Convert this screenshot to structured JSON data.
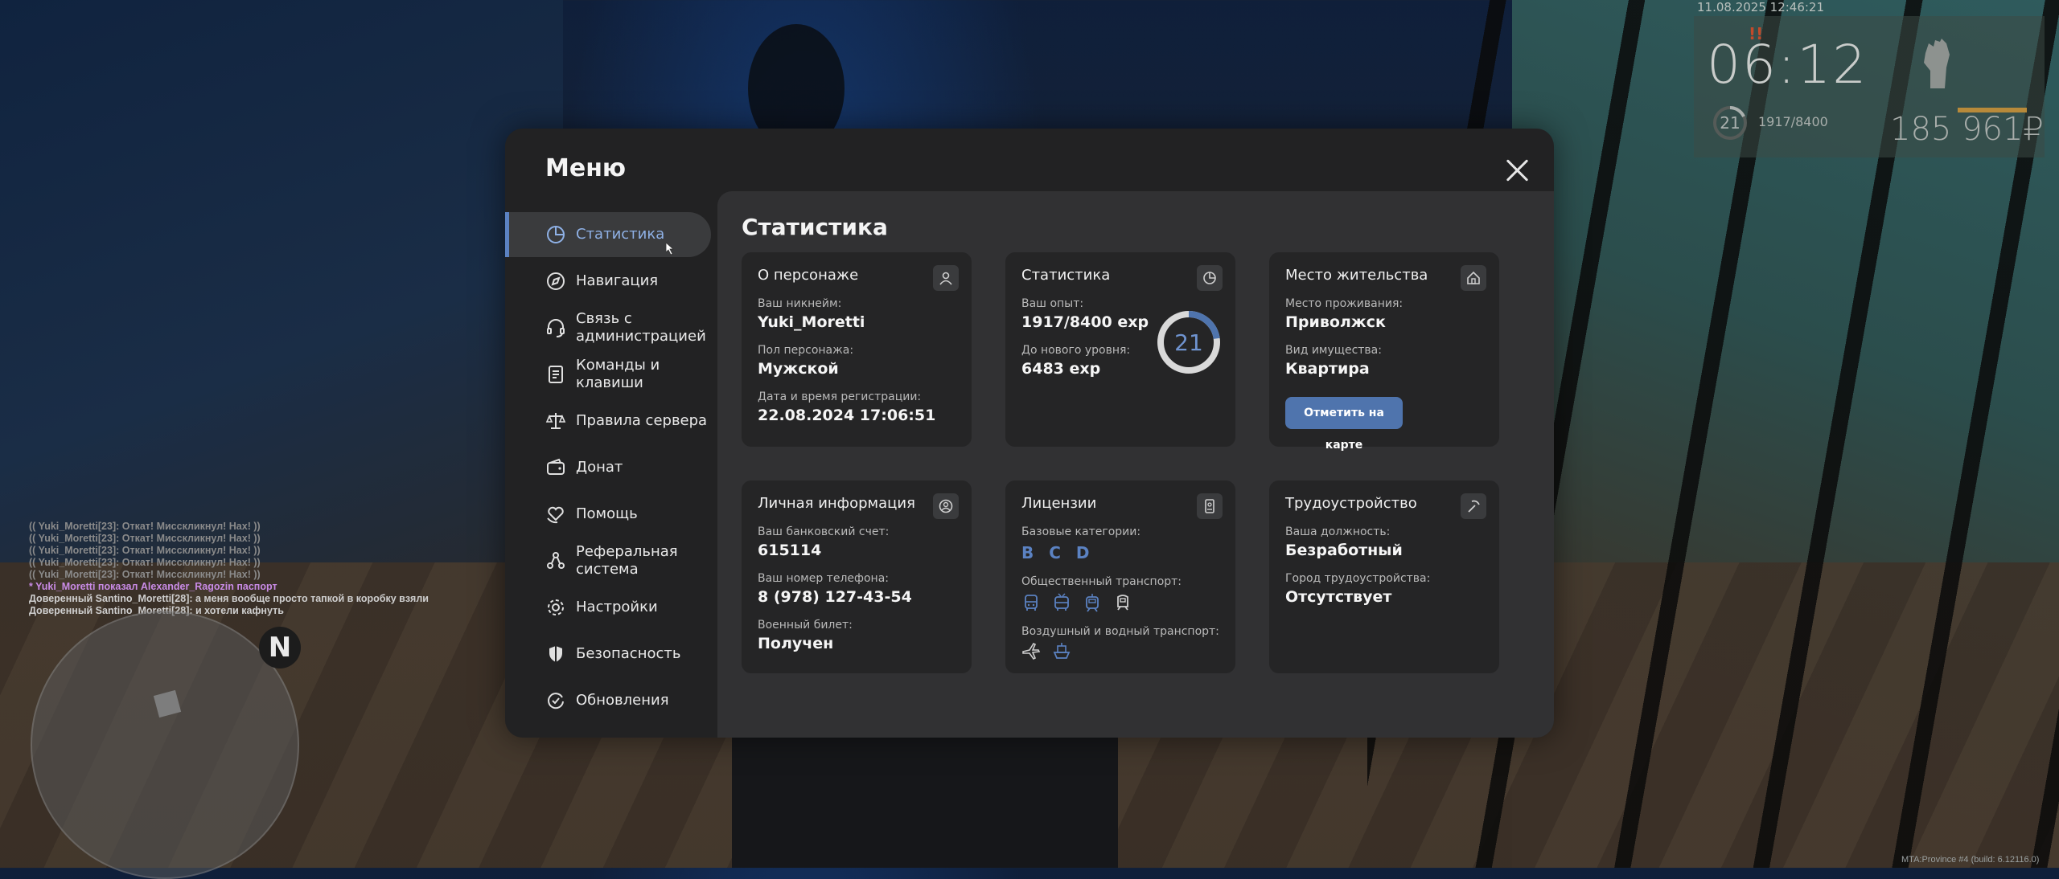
{
  "hud": {
    "datetime": "11.08.2025 12:46:21",
    "time": "06:12",
    "alert": "!!",
    "level": "21",
    "exp": "1917/8400",
    "money": "185 961₽"
  },
  "chat": [
    {
      "text": "(( Yuki_Moretti[23]: Откат! Мисскликнул! Нах! ))",
      "color": "#8a8a8a"
    },
    {
      "text": "(( Yuki_Moretti[23]: Откат! Мисскликнул! Нах! ))",
      "color": "#8a8a8a"
    },
    {
      "text": "(( Yuki_Moretti[23]: Откат! Мисскликнул! Нах! ))",
      "color": "#8a8a8a"
    },
    {
      "text": "(( Yuki_Moretti[23]: Откат! Мисскликнул! Нах! ))",
      "color": "#8a8a8a"
    },
    {
      "text": "(( Yuki_Moretti[23]: Откат! Мисскликнул! Нах! ))",
      "color": "#8a8a8a"
    },
    {
      "text": "* Yuki_Moretti показал Alexander_Ragozin паспорт",
      "color": "#c98be6"
    },
    {
      "text": "Доверенный Santino_Moretti[28]: а меня вообще просто тапкой в коробку взяли",
      "color": "#cfcfcf"
    },
    {
      "text": "Доверенный Santino_Moretti[28]: и хотели кафнуть",
      "color": "#cfcfcf"
    }
  ],
  "radar": {
    "north": "N"
  },
  "footer": "MTA:Province #4 (build: 6.12116.0)",
  "menu": {
    "title": "Меню",
    "nav": [
      {
        "label": "Статистика",
        "icon": "pie-chart-icon",
        "active": true
      },
      {
        "label": "Навигация",
        "icon": "compass-icon"
      },
      {
        "label": "Связь с администрацией",
        "icon": "headset-icon"
      },
      {
        "label": "Команды и клавиши",
        "icon": "document-icon"
      },
      {
        "label": "Правила сервера",
        "icon": "scales-icon"
      },
      {
        "label": "Донат",
        "icon": "wallet-icon"
      },
      {
        "label": "Помощь",
        "icon": "heart-hand-icon"
      },
      {
        "label": "Реферальная система",
        "icon": "referral-icon"
      },
      {
        "label": "Настройки",
        "icon": "gear-icon"
      },
      {
        "label": "Безопасность",
        "icon": "shield-icon"
      },
      {
        "label": "Обновления",
        "icon": "refresh-check-icon"
      }
    ],
    "content_title": "Статистика",
    "cards": {
      "character": {
        "title": "О персонаже",
        "nickname_label": "Ваш никнейм:",
        "nickname": "Yuki_Moretti",
        "gender_label": "Пол персонажа:",
        "gender": "Мужской",
        "reg_label": "Дата и время регистрации:",
        "reg": "22.08.2024 17:06:51"
      },
      "stats": {
        "title": "Статистика",
        "exp_label": "Ваш опыт:",
        "exp": "1917/8400 exp",
        "next_label": "До нового уровня:",
        "next": "6483 exp",
        "level": "21",
        "progress": 0.228
      },
      "residence": {
        "title": "Место жительства",
        "place_label": "Место проживания:",
        "place": "Приволжск",
        "property_label": "Вид имущества:",
        "property": "Квартира",
        "map_button": "Отметить на карте"
      },
      "personal": {
        "title": "Личная информация",
        "bank_label": "Ваш банковский счет:",
        "bank": "615114",
        "phone_label": "Ваш номер телефона:",
        "phone": "8 (978) 127-43-54",
        "military_label": "Военный билет:",
        "military": "Получен"
      },
      "licenses": {
        "title": "Лицензии",
        "base_label": "Базовые категории:",
        "base": [
          "B",
          "C",
          "D"
        ],
        "public_label": "Общественный транспорт:",
        "air_label": "Воздушный и водный транспорт:"
      },
      "job": {
        "title": "Трудоустройство",
        "position_label": "Ваша должность:",
        "position": "Безработный",
        "city_label": "Город трудоустройства:",
        "city": "Отсутствует"
      }
    }
  },
  "colors": {
    "accent": "#5b82c2",
    "panel": "#222223",
    "content": "#313133",
    "card": "#252526"
  }
}
